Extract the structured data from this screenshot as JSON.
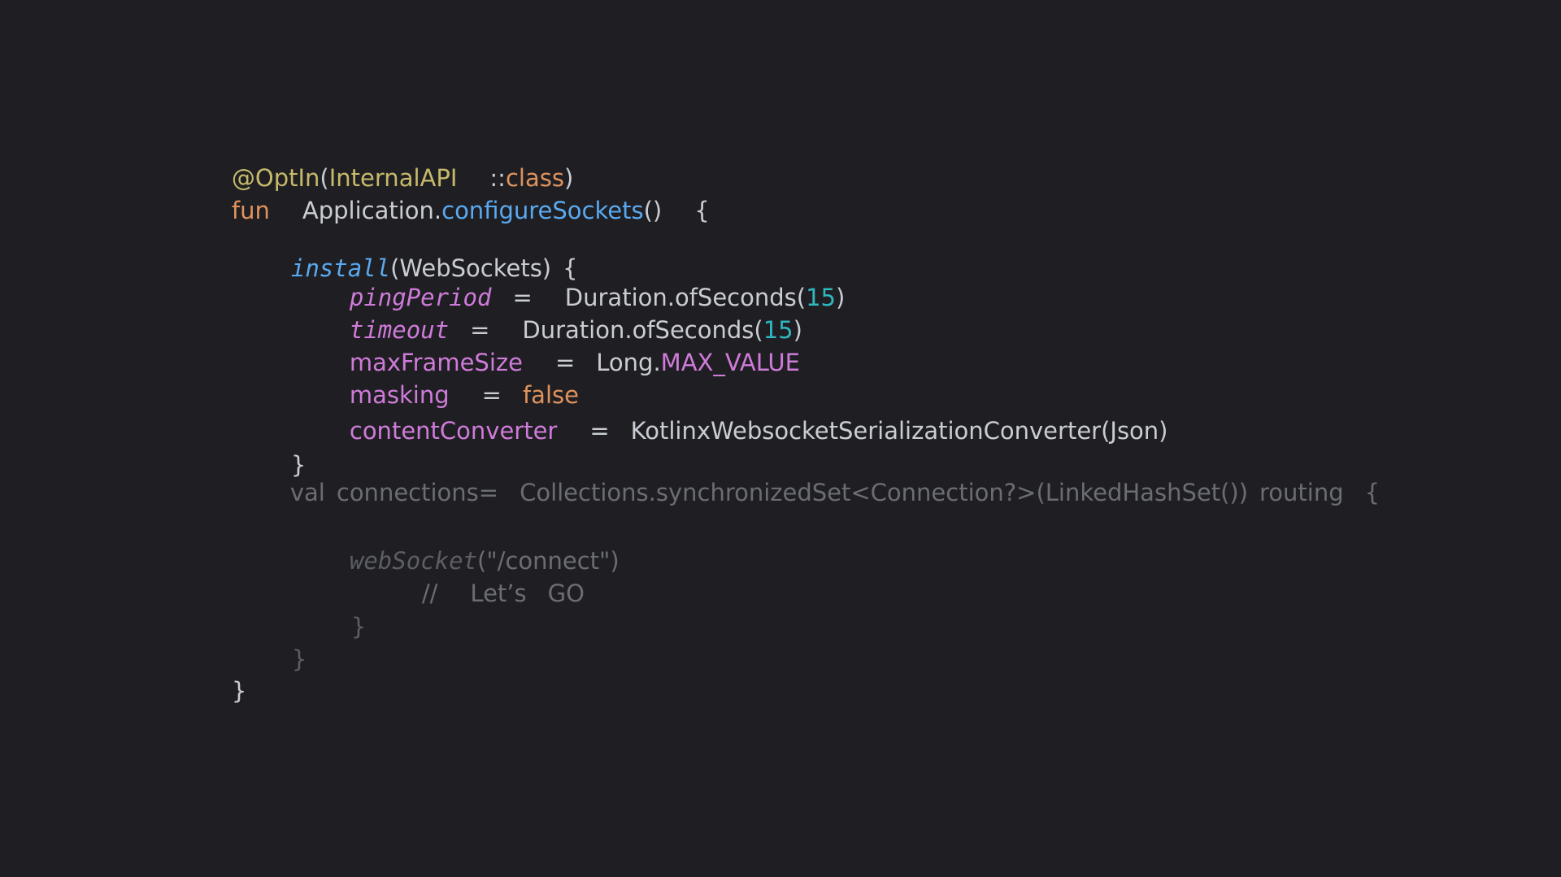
{
  "code": {
    "line1": {
      "annotation": "@OptIn",
      "open": "(",
      "type": "InternalAPI",
      "sep": "::",
      "class_kw": "class",
      "close": ")"
    },
    "line2": {
      "fun_kw": "fun",
      "receiver": "Application.",
      "name": "configureSockets",
      "parens": "()",
      "brace": "{"
    },
    "line3": {
      "call": "install",
      "arg": "(WebSockets)",
      "brace": "{"
    },
    "line4": {
      "prop": "pingPeriod",
      "eq": "=",
      "expr": "Duration.ofSeconds(",
      "num": "15",
      "close": ")"
    },
    "line5": {
      "prop": "timeout",
      "eq": "=",
      "expr": "Duration.ofSeconds(",
      "num": "15",
      "close": ")"
    },
    "line6": {
      "prop": "maxFrameSize",
      "eq": "=",
      "expr": "Long.",
      "const": "MAX_VALUE"
    },
    "line7": {
      "prop": "masking",
      "eq": "=",
      "value": "false"
    },
    "line8": {
      "prop": "contentConverter",
      "eq": "=",
      "expr": "KotlinxWebsocketSerializationConverter(Json)"
    },
    "line9": {
      "brace": "}"
    },
    "line10": {
      "val_kw": "val",
      "name": "connections=",
      "expr": "Collections.synchronizedSet<Connection?>(LinkedHashSet())",
      "routing": "routing",
      "brace": "{"
    },
    "line11": {
      "call": "webSocket",
      "arg": "(\"/connect\")"
    },
    "line12": {
      "comment_slashes": "//",
      "comment_word1": "Let’s",
      "comment_word2": "GO"
    },
    "line13": {
      "brace": "}"
    },
    "line14": {
      "brace": "}"
    },
    "line15": {
      "brace": "}"
    }
  }
}
